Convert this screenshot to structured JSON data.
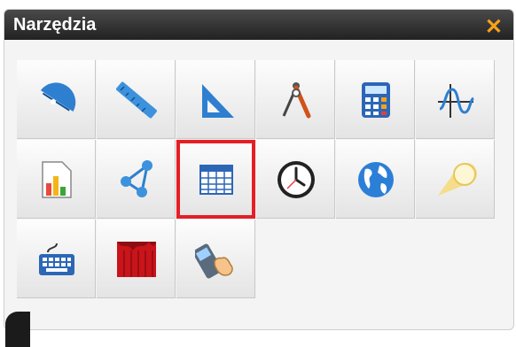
{
  "window": {
    "title": "Narzędzia",
    "close_label": "✕"
  },
  "tools": [
    {
      "icon": "protractor-icon"
    },
    {
      "icon": "ruler-icon"
    },
    {
      "icon": "set-square-icon"
    },
    {
      "icon": "compass-icon"
    },
    {
      "icon": "calculator-icon"
    },
    {
      "icon": "function-graph-icon"
    },
    {
      "icon": "chart-document-icon"
    },
    {
      "icon": "geometry-shapes-icon"
    },
    {
      "icon": "table-icon",
      "selected": true
    },
    {
      "icon": "clock-icon"
    },
    {
      "icon": "globe-icon"
    },
    {
      "icon": "spotlight-icon"
    },
    {
      "icon": "keyboard-icon"
    },
    {
      "icon": "curtain-icon"
    },
    {
      "icon": "touch-device-icon"
    }
  ],
  "colors": {
    "title_bar": "#2a2a2a",
    "close": "#f7a21b",
    "selection": "#e41f26",
    "tile": "#f0f0f0"
  }
}
